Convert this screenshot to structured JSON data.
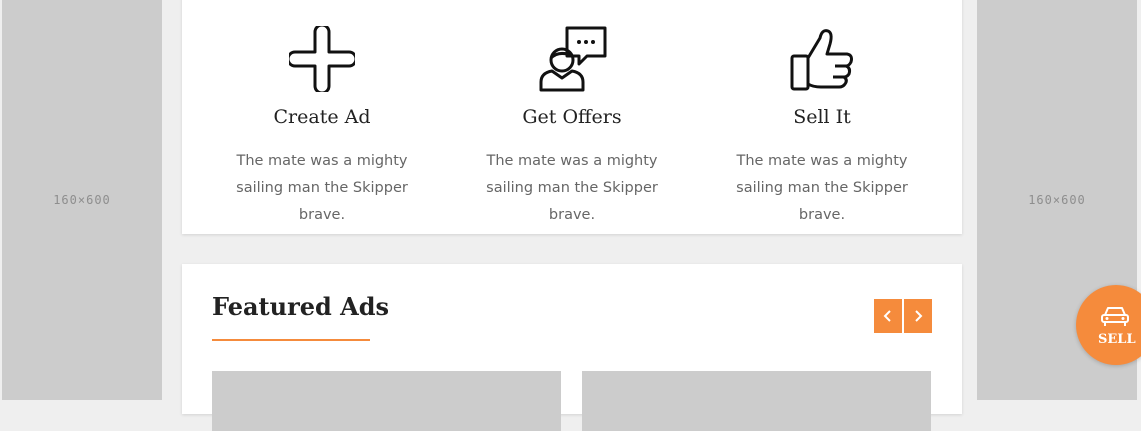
{
  "side_ads": {
    "left_label": "160×600",
    "right_label": "160×600"
  },
  "steps": [
    {
      "icon": "plus-icon",
      "title": "Create Ad",
      "description": "The mate was a mighty sailing man the Skipper brave."
    },
    {
      "icon": "person-chat-icon",
      "title": "Get Offers",
      "description": "The mate was a mighty sailing man the Skipper brave."
    },
    {
      "icon": "thumbs-up-icon",
      "title": "Sell It",
      "description": "The mate was a mighty sailing man the Skipper brave."
    }
  ],
  "featured": {
    "title": "Featured Ads",
    "prev_icon": "chevron-left-icon",
    "next_icon": "chevron-right-icon"
  },
  "sell_button": {
    "label": "SELL",
    "icon": "car-icon"
  },
  "colors": {
    "accent": "#f58b3c",
    "page_background": "#efefef",
    "placeholder": "#cccccc"
  }
}
